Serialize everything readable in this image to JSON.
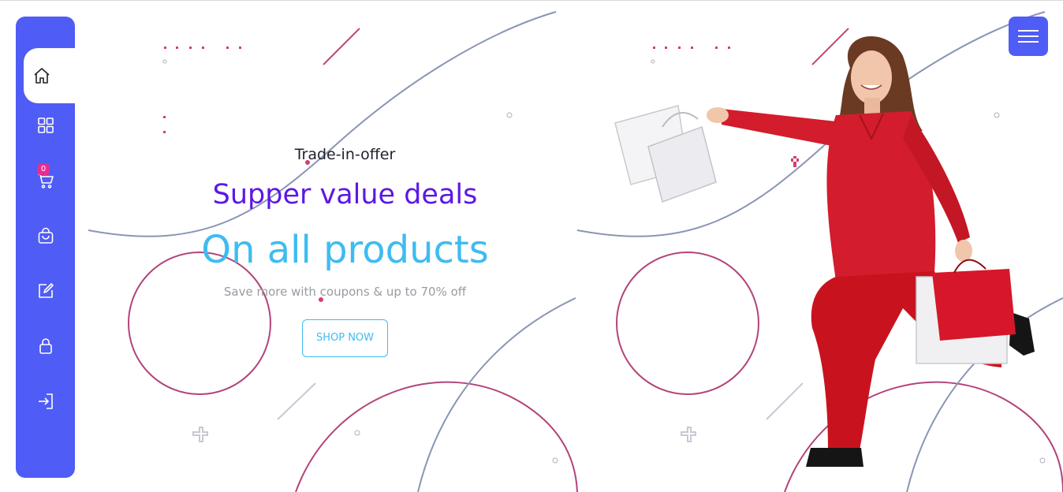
{
  "sidebar": {
    "items": [
      {
        "icon": "home-icon",
        "active": true
      },
      {
        "icon": "grid-icon"
      },
      {
        "icon": "cart-icon",
        "badge": "0"
      },
      {
        "icon": "bag-icon"
      },
      {
        "icon": "edit-icon"
      },
      {
        "icon": "lock-icon"
      },
      {
        "icon": "login-icon"
      }
    ],
    "cart_badge": "0"
  },
  "hero": {
    "kicker": "Trade-in-offer",
    "headline": "Supper value deals",
    "subheadline": "On all products",
    "description": "Save more with coupons & up to 70% off",
    "cta_label": "SHOP NOW"
  },
  "colors": {
    "sidebar_bg": "#4f5cf6",
    "headline": "#5c18e6",
    "subheadline": "#3ebcf0",
    "badge": "#e92c8f",
    "outfit": "#d31c2c"
  }
}
